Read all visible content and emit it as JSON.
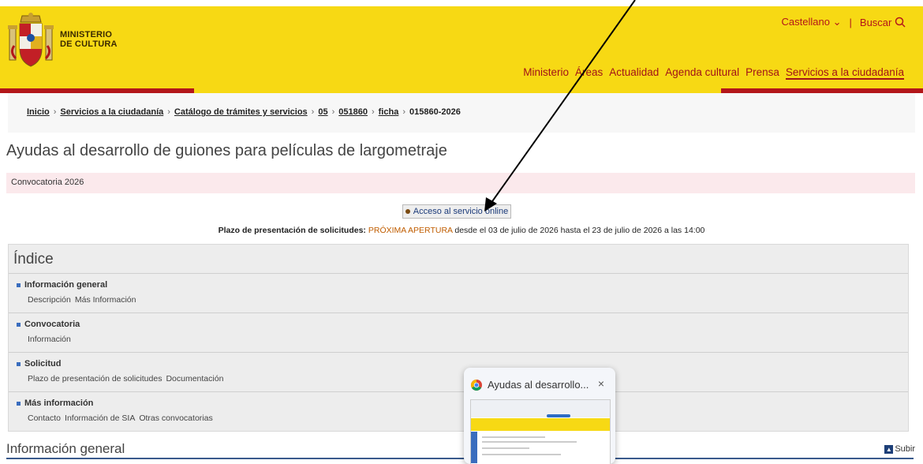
{
  "header": {
    "ministry_line1": "MINISTERIO",
    "ministry_line2": "DE CULTURA",
    "language": "Castellano",
    "search_label": "Buscar",
    "nav": [
      "Ministerio",
      "Áreas",
      "Actualidad",
      "Agenda cultural",
      "Prensa",
      "Servicios a la ciudadanía"
    ],
    "brand_yellow": "#f7d914",
    "brand_red": "#b3161a"
  },
  "breadcrumb": {
    "items": [
      "Inicio",
      "Servicios a la ciudadanía",
      "Catálogo de trámites y servicios",
      "05",
      "051860",
      "ficha"
    ],
    "current": "015860-2026"
  },
  "page": {
    "title": "Ayudas al desarrollo de guiones para películas de largometraje",
    "convocatoria": "Convocatoria 2026",
    "access_button": "Acceso al servicio online",
    "plazo_label": "Plazo de presentación de solicitudes:",
    "plazo_status": "PRÓXIMA APERTURA",
    "plazo_text": "desde el 03 de julio de 2026 hasta el 23 de julio de 2026 a las 14:00"
  },
  "index": {
    "title": "Índice",
    "sections": [
      {
        "heading": "Información general",
        "links": [
          "Descripción",
          "Más Información"
        ]
      },
      {
        "heading": "Convocatoria",
        "links": [
          "Información"
        ]
      },
      {
        "heading": "Solicitud",
        "links": [
          "Plazo de presentación de solicitudes",
          "Documentación"
        ]
      },
      {
        "heading": "Más información",
        "links": [
          "Contacto",
          "Información de SIA",
          "Otras convocatorias"
        ]
      }
    ]
  },
  "footer": {
    "section_title": "Información general",
    "subir": "Subir"
  },
  "popup": {
    "title": "Ayudas al desarrollo...",
    "close": "×"
  }
}
